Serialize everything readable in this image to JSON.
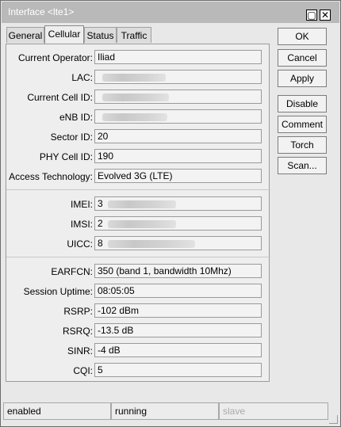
{
  "window": {
    "title": "Interface <lte1>",
    "minimize_glyph": "▢",
    "close_glyph": "✕"
  },
  "tabs": [
    {
      "label": "General"
    },
    {
      "label": "Cellular"
    },
    {
      "label": "Status"
    },
    {
      "label": "Traffic"
    }
  ],
  "fields": {
    "current_operator": {
      "label": "Current Operator:",
      "value": "Iliad"
    },
    "lac": {
      "label": "LAC:",
      "value": ""
    },
    "current_cell_id": {
      "label": "Current Cell ID:",
      "value": ""
    },
    "enb_id": {
      "label": "eNB ID:",
      "value": ""
    },
    "sector_id": {
      "label": "Sector ID:",
      "value": "20"
    },
    "phy_cell_id": {
      "label": "PHY Cell ID:",
      "value": "190"
    },
    "access_technology": {
      "label": "Access Technology:",
      "value": "Evolved 3G (LTE)"
    },
    "imei": {
      "label": "IMEI:",
      "value": "3"
    },
    "imsi": {
      "label": "IMSI:",
      "value": "2"
    },
    "uicc": {
      "label": "UICC:",
      "value": "8"
    },
    "earfcn": {
      "label": "EARFCN:",
      "value": "350 (band 1, bandwidth 10Mhz)"
    },
    "session_uptime": {
      "label": "Session Uptime:",
      "value": "08:05:05"
    },
    "rsrp": {
      "label": "RSRP:",
      "value": "-102 dBm"
    },
    "rsrq": {
      "label": "RSRQ:",
      "value": "-13.5 dB"
    },
    "sinr": {
      "label": "SINR:",
      "value": "-4 dB"
    },
    "cqi": {
      "label": "CQI:",
      "value": "5"
    }
  },
  "buttons": {
    "ok": "OK",
    "cancel": "Cancel",
    "apply": "Apply",
    "disable": "Disable",
    "comment": "Comment",
    "torch": "Torch",
    "scan": "Scan..."
  },
  "status": {
    "enabled": "enabled",
    "running": "running",
    "slave": "slave"
  }
}
